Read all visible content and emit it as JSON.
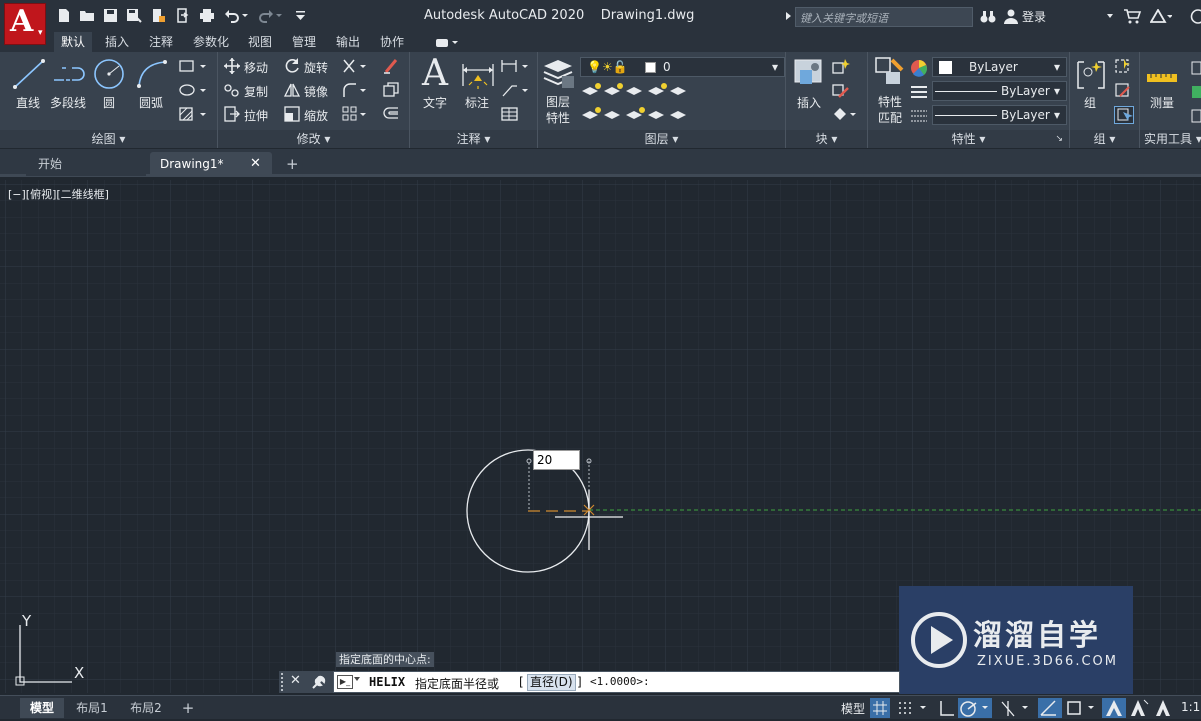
{
  "titlebar": {
    "app_button_letter": "A",
    "title": "Autodesk AutoCAD 2020    Drawing1.dwg",
    "search_placeholder": "键入关键字或短语",
    "login_label": "登录",
    "qat_icons": [
      "new-icon",
      "open-icon",
      "save-icon",
      "saveas-icon",
      "plot-icon",
      "import-icon",
      "export-icon",
      "print-icon",
      "undo-icon",
      "redo-icon",
      "customize-icon"
    ]
  },
  "ribbon_tabs": [
    "默认",
    "插入",
    "注释",
    "参数化",
    "视图",
    "管理",
    "输出",
    "协作"
  ],
  "ribbon": {
    "draw": {
      "title": "绘图",
      "line": "直线",
      "polyline": "多段线",
      "circle": "圆",
      "arc": "圆弧"
    },
    "modify": {
      "title": "修改",
      "move": "移动",
      "rotate": "旋转",
      "copy": "复制",
      "mirror": "镜像",
      "stretch": "拉伸",
      "scale": "缩放"
    },
    "annotation": {
      "title": "注释",
      "text": "文字",
      "dimension": "标注"
    },
    "layers": {
      "title": "图层",
      "layer_properties": "图层\n特性",
      "current_layer": "0"
    },
    "block": {
      "title": "块",
      "insert": "插入"
    },
    "properties": {
      "title": "特性",
      "match": "特性\n匹配",
      "color": "ByLayer",
      "linetype": "ByLayer",
      "lineweight": "ByLayer"
    },
    "groups": {
      "title": "组",
      "group": "组"
    },
    "utilities": {
      "title": "实用工具",
      "measure": "测量"
    }
  },
  "doc_tabs": [
    {
      "label": "开始"
    },
    {
      "label": "Drawing1*"
    }
  ],
  "viewport_label": "[−][俯视][二维线框]",
  "dynamic_input": "20",
  "ucs": {
    "x": "X",
    "y": "Y"
  },
  "command": {
    "prompt_history": "指定底面的中心点:",
    "command_name": "HELIX",
    "text": "指定底面半径或",
    "option": "直径(D)",
    "default": "<1.0000>:"
  },
  "layout_tabs": [
    "模型",
    "布局1",
    "布局2"
  ],
  "statusbar": {
    "model_label": "模型",
    "scale": "1:1"
  },
  "watermark": {
    "name": "溜溜自学",
    "url": "ZIXUE.3D66.COM"
  },
  "colors": {
    "accent_red": "#c0161c",
    "canvas": "#212830",
    "ribbon": "#38424e"
  }
}
